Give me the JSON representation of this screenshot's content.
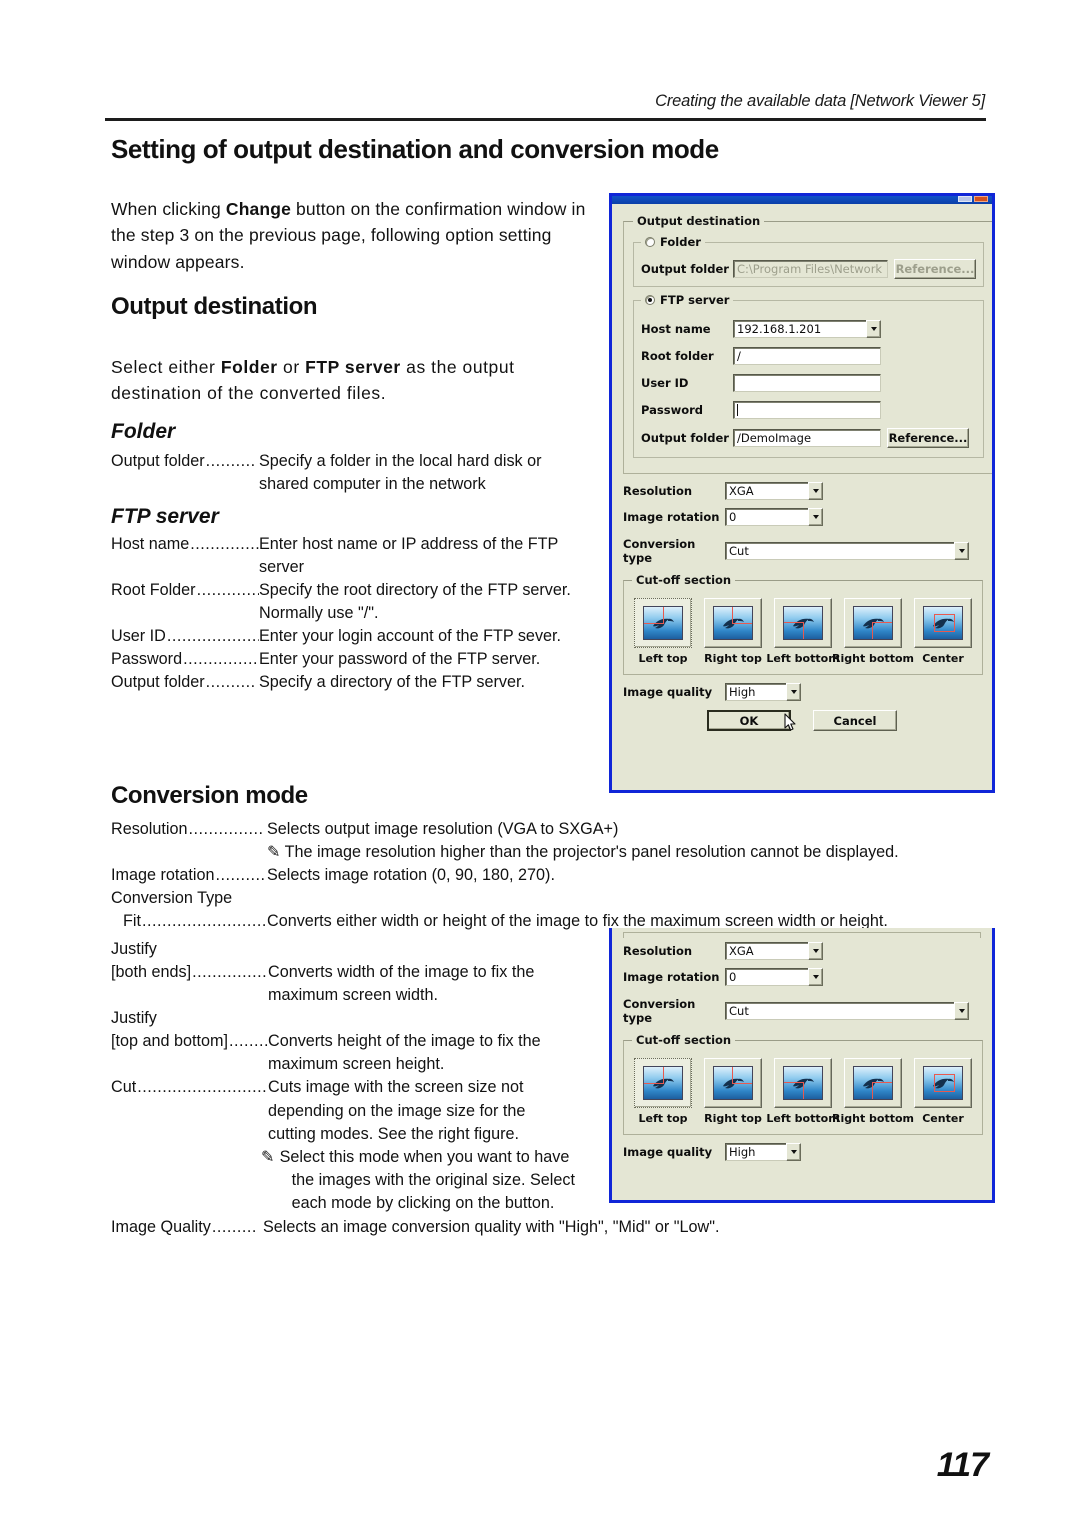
{
  "header": {
    "running_head": "Creating the available data [Network Viewer 5]",
    "page_number": "117"
  },
  "sections": {
    "title": "Setting of output destination and conversion mode",
    "intro_1": "When clicking ",
    "intro_bold": "Change",
    "intro_2": " button on the confirmation window in the step 3 on the previous page, following option setting window appears.",
    "output_destination_heading": "Output destination",
    "lead_1": "Select either ",
    "lead_bold_1": "Folder",
    "lead_2": " or ",
    "lead_bold_2": "FTP server",
    "lead_3": " as the output destination of the converted files.",
    "folder_heading": "Folder",
    "ftp_heading": "FTP server",
    "conversion_mode_heading": "Conversion mode"
  },
  "folder_defs": [
    {
      "term": "Output folder",
      "dots": "..........",
      "desc": "Specify a folder in the local hard disk or",
      "cont": "shared computer in the network"
    }
  ],
  "ftp_defs": [
    {
      "term": "Host name",
      "dots": "................",
      "desc": "Enter host name or IP address of the FTP",
      "cont": "server"
    },
    {
      "term": "Root Folder",
      "dots": "..............",
      "desc": "Specify the root directory of the FTP server.",
      "cont": "Normally use \"/\"."
    },
    {
      "term": "User ID",
      "dots": "......................",
      "desc": "Enter your login account of the FTP sever.",
      "cont": ""
    },
    {
      "term": "Password",
      "dots": "..................",
      "desc": "Enter your password of the FTP server.",
      "cont": ""
    },
    {
      "term": "Output folder",
      "dots": "..........",
      "desc": "Specify a directory of the FTP server.",
      "cont": ""
    }
  ],
  "conv_top": {
    "resolution_term": "Resolution",
    "resolution_dots": "...............",
    "resolution_desc": "Selects output image resolution (VGA to SXGA+)",
    "resolution_note": "The image resolution higher than the projector's panel resolution cannot be displayed.",
    "rotation_term": "Image rotation",
    "rotation_dots": "..........",
    "rotation_desc": "Selects image rotation (0, 90, 180, 270).",
    "conversion_type_label": "Conversion Type",
    "fit_term": "Fit",
    "fit_dots": "..............................",
    "fit_desc": "Converts either width or height of the image  to fix the maximum screen width or height."
  },
  "conv_types": [
    {
      "justify": "Justify",
      "term": "[both ends]",
      "dots": "..................",
      "desc": "Converts width of the image to fix the",
      "cont": "maximum screen width."
    },
    {
      "justify": "Justify",
      "term": "[top and bottom]",
      "dots": "..........",
      "desc": "Converts height of the image to fix the",
      "cont": "maximum screen height."
    },
    {
      "justify": "",
      "term": "Cut",
      "dots": "...........................",
      "desc": "Cuts image with the screen size not",
      "cont": "depending on the image size for the",
      "cont2": "cutting modes. See the right figure."
    }
  ],
  "cut_note": {
    "line1": "Select this mode when you want to have",
    "line2": "the images with the original size. Select",
    "line3": "each mode by clicking on the button."
  },
  "quality_def": {
    "term": "Image Quality",
    "dots": ".........",
    "desc": "Selects an image conversion quality with \"High\", \"Mid\" or \"Low\"."
  },
  "dialog": {
    "output_destination_group": "Output destination",
    "folder_radio_label": "Folder",
    "folder_radio_selected": false,
    "folder_output_folder_label": "Output folder",
    "folder_output_folder_value": "C:\\Program Files\\Network",
    "folder_reference_button": "Reference...",
    "ftp_radio_label": "FTP server",
    "ftp_radio_selected": true,
    "host_name_label": "Host name",
    "host_name_value": "192.168.1.201",
    "root_folder_label": "Root folder",
    "root_folder_value": "/",
    "user_id_label": "User ID",
    "user_id_value": "",
    "password_label": "Password",
    "password_value": "",
    "ftp_output_folder_label": "Output folder",
    "ftp_output_folder_value": "/DemoImage",
    "ftp_reference_button": "Reference...",
    "resolution_label": "Resolution",
    "resolution_value": "XGA",
    "image_rotation_label": "Image rotation",
    "image_rotation_value": "0",
    "conversion_type_label": "Conversion type",
    "conversion_type_value": "Cut",
    "cutoff_group_label": "Cut-off section",
    "cutoff_options": [
      {
        "label": "Left top",
        "selected": true
      },
      {
        "label": "Right top",
        "selected": false
      },
      {
        "label": "Left bottom",
        "selected": false
      },
      {
        "label": "Right bottom",
        "selected": false
      },
      {
        "label": "Center",
        "selected": false
      }
    ],
    "image_quality_label": "Image quality",
    "image_quality_value": "High",
    "ok_button": "OK",
    "cancel_button": "Cancel"
  },
  "colors": {
    "dialog_border": "#1026d8",
    "dialog_face": "#e4e6d4",
    "marquee": "#e8594f",
    "titlebar": "#0a3fa8"
  }
}
